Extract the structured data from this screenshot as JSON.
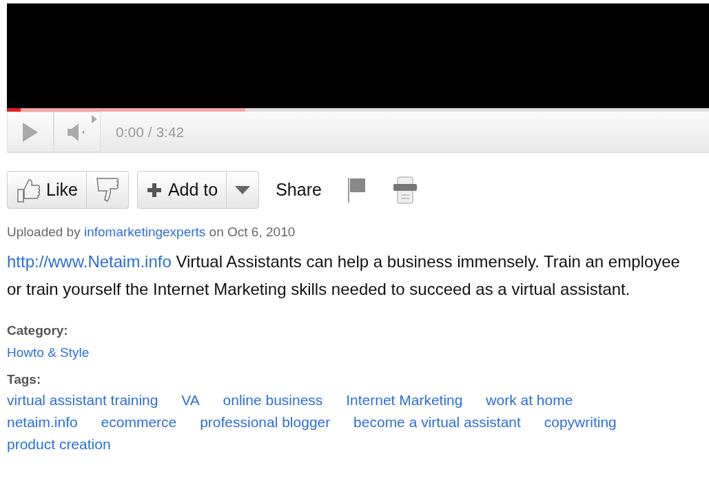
{
  "player": {
    "played": {
      "level": 0.02
    },
    "buffered": {
      "level": 0.34
    },
    "time": "0:00 / 3:42"
  },
  "actions": {
    "like": "Like",
    "add_to": "Add to",
    "share": "Share"
  },
  "upload": {
    "prefix": "Uploaded by",
    "user": "infomarketingexperts",
    "suffix": "on Oct 6, 2010"
  },
  "description": {
    "link": "http://www.Netaim.info",
    "text": "Virtual Assistants can help a business immensely. Train an employee or train yourself the Internet Marketing skills needed to succeed as a virtual assistant."
  },
  "category": {
    "label": "Category:",
    "value": "Howto & Style"
  },
  "tags": {
    "label": "Tags:",
    "items": [
      "virtual assistant training",
      "VA",
      "online business",
      "Internet Marketing",
      "work at home",
      "netaim.info",
      "ecommerce",
      "professional blogger",
      "become a virtual assistant",
      "copywriting",
      "product creation"
    ]
  }
}
